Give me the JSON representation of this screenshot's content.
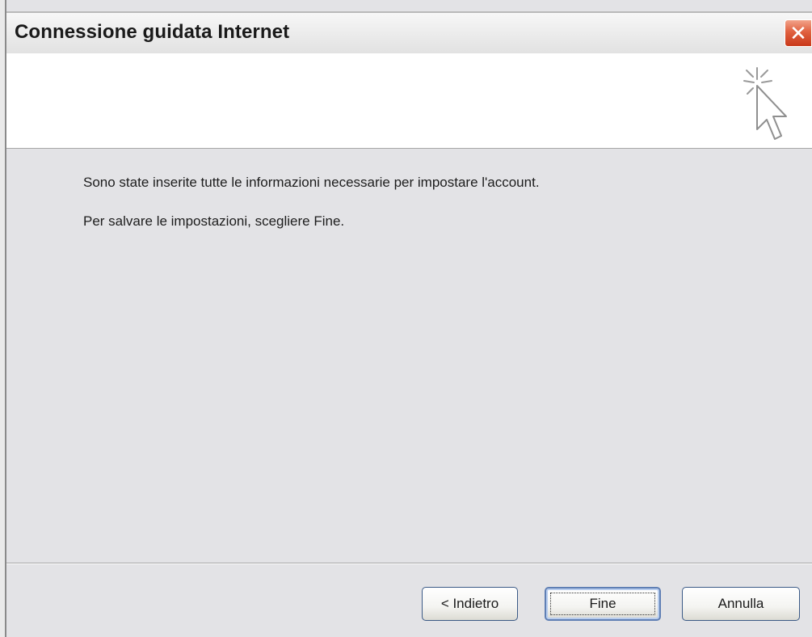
{
  "window": {
    "title": "Connessione guidata Internet",
    "close_glyph": "✕"
  },
  "header": {
    "icon": "wizard-cursor-icon"
  },
  "content": {
    "line1": "Sono state inserite tutte le informazioni necessarie per impostare l'account.",
    "line2": "Per salvare le impostazioni, scegliere Fine."
  },
  "buttons": {
    "back": "< Indietro",
    "finish": "Fine",
    "cancel": "Annulla"
  },
  "colors": {
    "close_button": "#d8502e",
    "button_border": "#3b5a86",
    "dialog_background": "#e3e3e6"
  }
}
